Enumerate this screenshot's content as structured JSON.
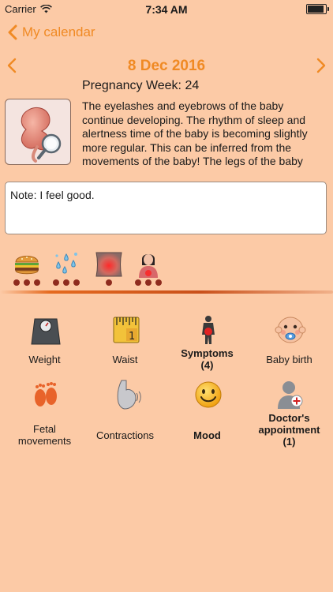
{
  "status_bar": {
    "carrier": "Carrier",
    "time": "7:34 AM"
  },
  "nav": {
    "back_label": "My calendar"
  },
  "date": {
    "title": "8 Dec 2016"
  },
  "pregnancy": {
    "week_label": "Pregnancy Week: 24",
    "description": "The eyelashes and eyebrows of the baby continue developing. The rhythm of sleep and alertness time of the baby is becoming slightly more regular. This can be inferred from the movements of the baby! The legs of the baby"
  },
  "note": {
    "text": "Note: I feel good."
  },
  "quick_icons": [
    {
      "icon": "burger-icon",
      "dots": 3
    },
    {
      "icon": "water-drops-icon",
      "dots": 3
    },
    {
      "icon": "belly-pain-icon",
      "dots": 1
    },
    {
      "icon": "woman-pain-icon",
      "dots": 3
    }
  ],
  "grid": {
    "weight": "Weight",
    "waist": "Waist",
    "symptoms_line1": "Symptoms",
    "symptoms_line2": "(4)",
    "baby_birth": "Baby birth",
    "fetal_line1": "Fetal",
    "fetal_line2": "movements",
    "contractions": "Contractions",
    "mood": "Mood",
    "doctor_line1": "Doctor's",
    "doctor_line2": "appointment",
    "doctor_line3": "(1)"
  },
  "colors": {
    "accent": "#f08a24",
    "background": "#fccaa6",
    "dots": "#8e2b1e"
  }
}
